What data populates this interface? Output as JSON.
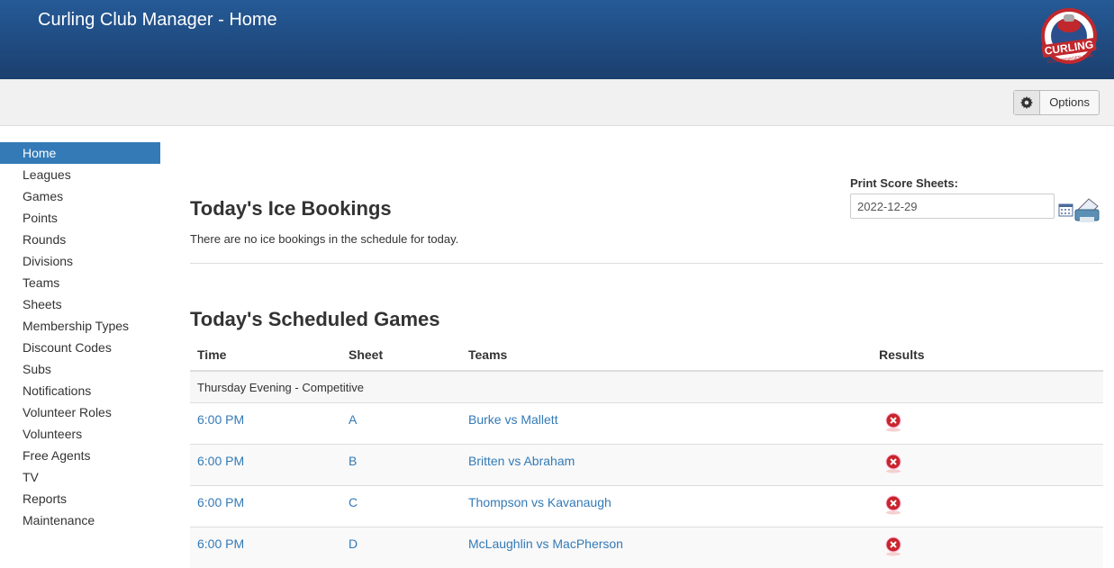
{
  "header": {
    "title": "Curling Club Manager - Home",
    "logo_text": "CURLING",
    "logo_subtext": "CLUBMANAGER.COM"
  },
  "toolbar": {
    "options_label": "Options",
    "options_icon": "gear-icon"
  },
  "sidebar": {
    "items": [
      {
        "label": "Home",
        "active": true
      },
      {
        "label": "Leagues"
      },
      {
        "label": "Games"
      },
      {
        "label": "Points"
      },
      {
        "label": "Rounds"
      },
      {
        "label": "Divisions"
      },
      {
        "label": "Teams"
      },
      {
        "label": "Sheets"
      },
      {
        "label": "Membership Types"
      },
      {
        "label": "Discount Codes"
      },
      {
        "label": "Subs"
      },
      {
        "label": "Notifications"
      },
      {
        "label": "Volunteer Roles"
      },
      {
        "label": "Volunteers"
      },
      {
        "label": "Free Agents"
      },
      {
        "label": "TV"
      },
      {
        "label": "Reports"
      },
      {
        "label": "Maintenance"
      }
    ]
  },
  "bookings": {
    "title": "Today's Ice Bookings",
    "empty_message": "There are no ice bookings in the schedule for today."
  },
  "print": {
    "label": "Print Score Sheets:",
    "date": "2022-12-29"
  },
  "games": {
    "title": "Today's Scheduled Games",
    "columns": [
      "Time",
      "Sheet",
      "Teams",
      "Results"
    ],
    "group": "Thursday Evening - Competitive",
    "rows": [
      {
        "time": "6:00 PM",
        "sheet": "A",
        "teams": "Burke vs Mallett"
      },
      {
        "time": "6:00 PM",
        "sheet": "B",
        "teams": "Britten vs Abraham"
      },
      {
        "time": "6:00 PM",
        "sheet": "C",
        "teams": "Thompson vs Kavanaugh"
      },
      {
        "time": "6:00 PM",
        "sheet": "D",
        "teams": "McLaughlin vs MacPherson"
      }
    ]
  }
}
